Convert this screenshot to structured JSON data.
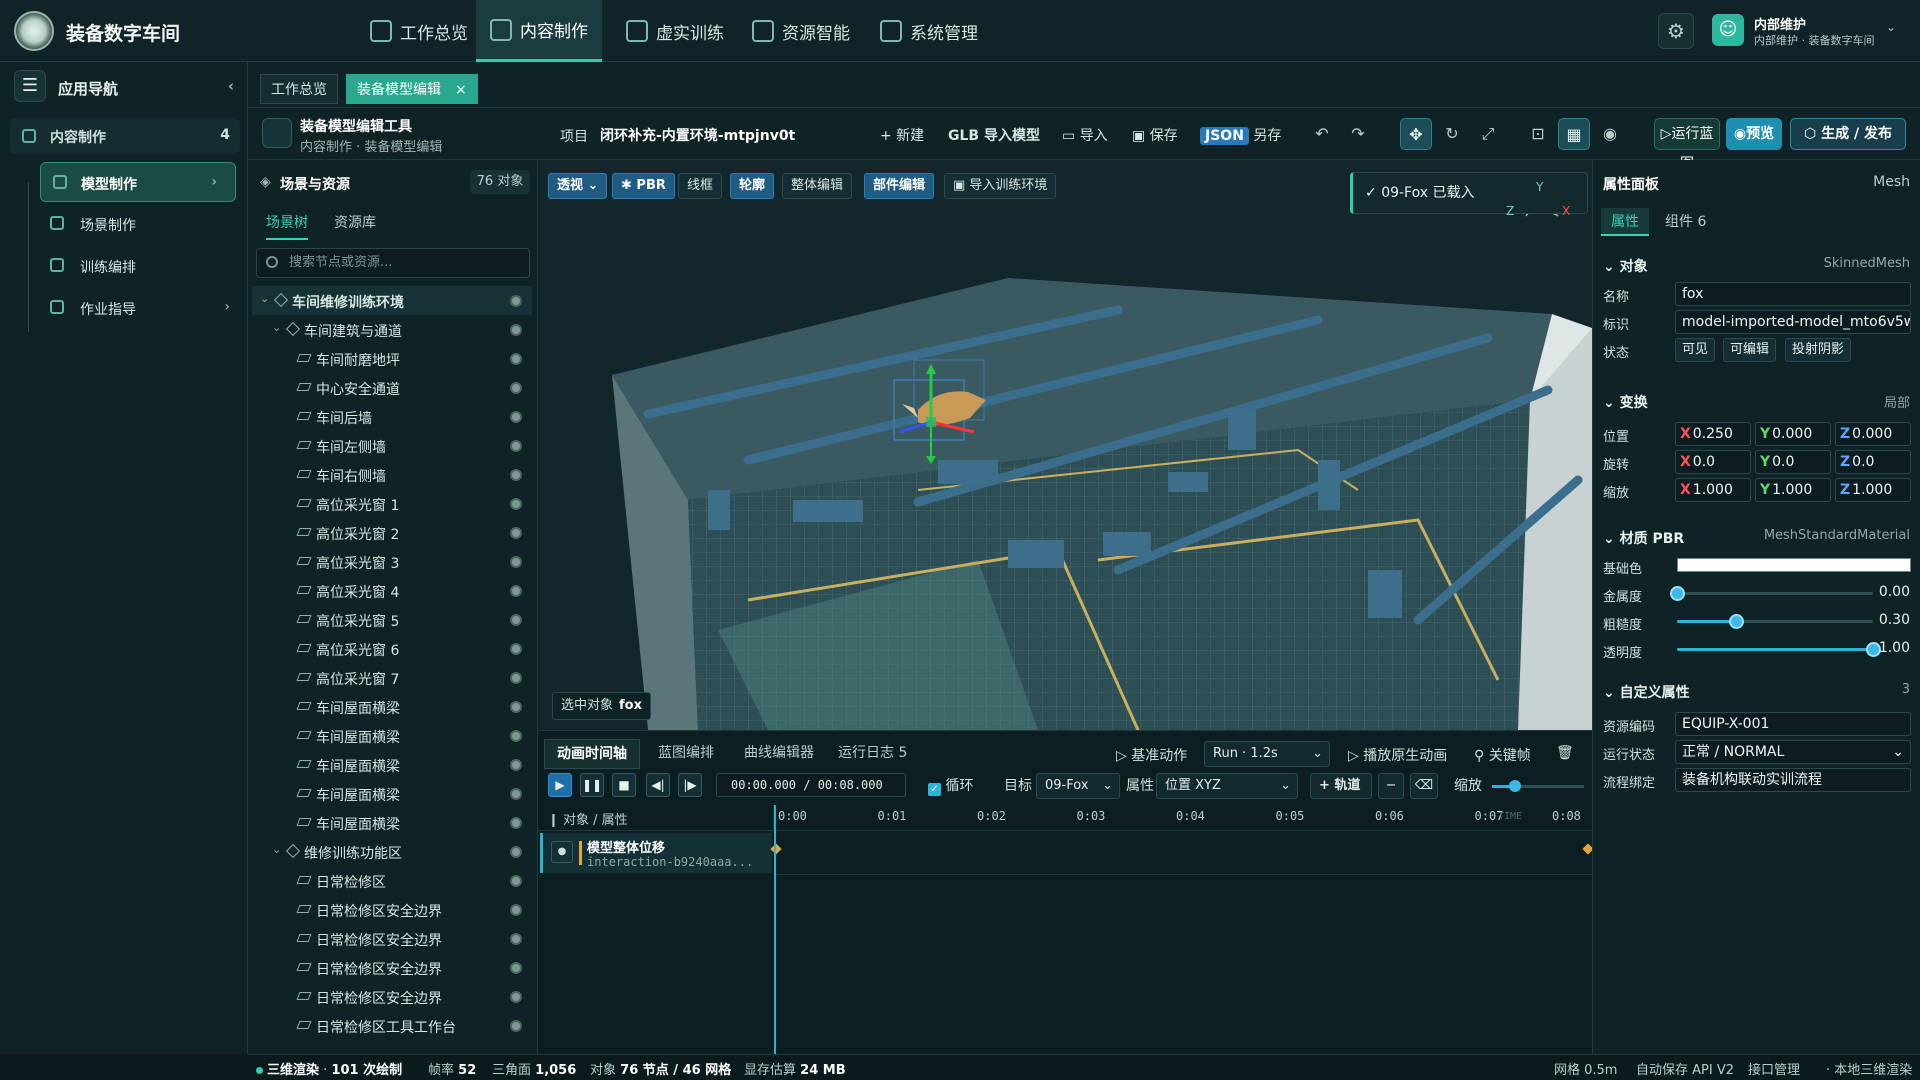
{
  "app": {
    "title": "装备数字车间"
  },
  "topnav": [
    {
      "label": "工作总览"
    },
    {
      "label": "内容制作"
    },
    {
      "label": "虚实训练"
    },
    {
      "label": "资源智能"
    },
    {
      "label": "系统管理"
    }
  ],
  "user": {
    "name": "内部维护",
    "sub": "内部维护 · 装备数字车间"
  },
  "leftnav": {
    "header": "应用导航",
    "section": {
      "label": "内容制作",
      "count": "4"
    },
    "items": [
      {
        "label": "模型制作"
      },
      {
        "label": "场景制作"
      },
      {
        "label": "训练编排"
      },
      {
        "label": "作业指导"
      }
    ]
  },
  "tabs": [
    {
      "label": "工作总览"
    },
    {
      "label": "装备模型编辑"
    }
  ],
  "toolbar": {
    "title": "装备模型编辑工具",
    "breadcrumb": "内容制作 · 装备模型编辑",
    "project_label": "项目",
    "project_name": "闭环补充-内置环境-mtpjnv0t",
    "new": "+ 新建",
    "glb_import": "GLB 导入模型",
    "import": "导入",
    "save": "保存",
    "json": "JSON",
    "save_as": "另存",
    "run_blueprint": "运行蓝图",
    "preview": "预览",
    "publish": "生成 / 发布"
  },
  "scene": {
    "title": "场景与资源",
    "count": "76 对象",
    "tab_scene": "场景树",
    "tab_assets": "资源库",
    "search_placeholder": "搜索节点或资源...",
    "tree": [
      {
        "label": "车间维修训练环境",
        "level": 0,
        "kind": "node"
      },
      {
        "label": "车间建筑与通道",
        "level": 1,
        "kind": "node"
      },
      {
        "label": "车间耐磨地坪",
        "level": 2,
        "kind": "mesh"
      },
      {
        "label": "中心安全通道",
        "level": 2,
        "kind": "mesh"
      },
      {
        "label": "车间后墙",
        "level": 2,
        "kind": "mesh"
      },
      {
        "label": "车间左侧墙",
        "level": 2,
        "kind": "mesh"
      },
      {
        "label": "车间右侧墙",
        "level": 2,
        "kind": "mesh"
      },
      {
        "label": "高位采光窗 1",
        "level": 2,
        "kind": "mesh"
      },
      {
        "label": "高位采光窗 2",
        "level": 2,
        "kind": "mesh"
      },
      {
        "label": "高位采光窗 3",
        "level": 2,
        "kind": "mesh"
      },
      {
        "label": "高位采光窗 4",
        "level": 2,
        "kind": "mesh"
      },
      {
        "label": "高位采光窗 5",
        "level": 2,
        "kind": "mesh"
      },
      {
        "label": "高位采光窗 6",
        "level": 2,
        "kind": "mesh"
      },
      {
        "label": "高位采光窗 7",
        "level": 2,
        "kind": "mesh"
      },
      {
        "label": "车间屋面横梁",
        "level": 2,
        "kind": "mesh"
      },
      {
        "label": "车间屋面横梁",
        "level": 2,
        "kind": "mesh"
      },
      {
        "label": "车间屋面横梁",
        "level": 2,
        "kind": "mesh"
      },
      {
        "label": "车间屋面横梁",
        "level": 2,
        "kind": "mesh"
      },
      {
        "label": "车间屋面横梁",
        "level": 2,
        "kind": "mesh"
      },
      {
        "label": "维修训练功能区",
        "level": 1,
        "kind": "node"
      },
      {
        "label": "日常检修区",
        "level": 2,
        "kind": "mesh"
      },
      {
        "label": "日常检修区安全边界",
        "level": 2,
        "kind": "mesh"
      },
      {
        "label": "日常检修区安全边界",
        "level": 2,
        "kind": "mesh"
      },
      {
        "label": "日常检修区安全边界",
        "level": 2,
        "kind": "mesh"
      },
      {
        "label": "日常检修区安全边界",
        "level": 2,
        "kind": "mesh"
      },
      {
        "label": "日常检修区工具工作台",
        "level": 2,
        "kind": "mesh"
      }
    ]
  },
  "viewport": {
    "buttons": [
      "透视",
      "PBR",
      "线框",
      "轮廓",
      "整体编辑",
      "部件编辑",
      "导入训练环境"
    ],
    "toast": "09-Fox 已载入",
    "selected_label": "选中对象",
    "selected_name": "fox",
    "axis_x": "X",
    "axis_y": "Y",
    "axis_z": "Z"
  },
  "timeline": {
    "tabs": [
      "动画时间轴",
      "蓝图编排",
      "曲线编辑器",
      "运行日志 5"
    ],
    "base_action": "基准动作",
    "clip": "Run · 1.2s",
    "play_original": "播放原生动画",
    "keyframe": "关键帧",
    "time": "00:00.000 / 00:08.000",
    "loop": "循环",
    "target_label": "目标",
    "target": "09-Fox",
    "prop_label": "属性",
    "prop": "位置 XYZ",
    "add_track": "+ 轨道",
    "zoom_label": "缩放",
    "zoom_level": 0.25,
    "header": "对象 / 属性",
    "ticks": [
      "0:00",
      "0:01",
      "0:02",
      "0:03",
      "0:04",
      "0:05",
      "0:06",
      "0:07",
      "0:08"
    ],
    "time_watermark": "TIME",
    "track_name": "模型整体位移",
    "track_id": "interaction-b9240aaa..."
  },
  "props": {
    "title": "属性面板",
    "tag": "Mesh",
    "tab_props": "属性",
    "tab_components": "组件 6",
    "object": {
      "header": "对象",
      "type": "SkinnedMesh",
      "name_label": "名称",
      "name": "fox",
      "id_label": "标识",
      "id": "model-imported-model_mto6v5w",
      "state_label": "状态",
      "states": [
        "可见",
        "可编辑",
        "投射阴影"
      ]
    },
    "transform": {
      "header": "变换",
      "scope": "局部",
      "pos_label": "位置",
      "rot_label": "旋转",
      "scale_label": "缩放",
      "pos": [
        "0.250",
        "0.000",
        "0.000"
      ],
      "rot": [
        "0.0",
        "0.0",
        "0.0"
      ],
      "scale": [
        "1.000",
        "1.000",
        "1.000"
      ]
    },
    "material": {
      "header": "材质 PBR",
      "type": "MeshStandardMaterial",
      "base_label": "基础色",
      "base_color": "#ffffff",
      "metal_label": "金属度",
      "metal": "0.00",
      "rough_label": "粗糙度",
      "rough": "0.30",
      "opacity_label": "透明度",
      "opacity": "1.00"
    },
    "custom": {
      "header": "自定义属性",
      "count": "3",
      "code_label": "资源编码",
      "code": "EQUIP-X-001",
      "status_label": "运行状态",
      "status": "正常 / NORMAL",
      "flow_label": "流程绑定",
      "flow": "装备机构联动实训流程"
    }
  },
  "status": {
    "render": "三维渲染",
    "draws": "101 次绘制",
    "fps_label": "帧率",
    "fps": "52",
    "tri_label": "三角面",
    "tri": "1,056",
    "obj_label": "对象",
    "obj": "76 节点 / 46 网格",
    "mem_label": "显存估算",
    "mem": "24 MB",
    "grid": "网格 0.5m",
    "autosave": "自动保存 API V2",
    "api": "接口管理",
    "local": "本地三维渲染"
  }
}
